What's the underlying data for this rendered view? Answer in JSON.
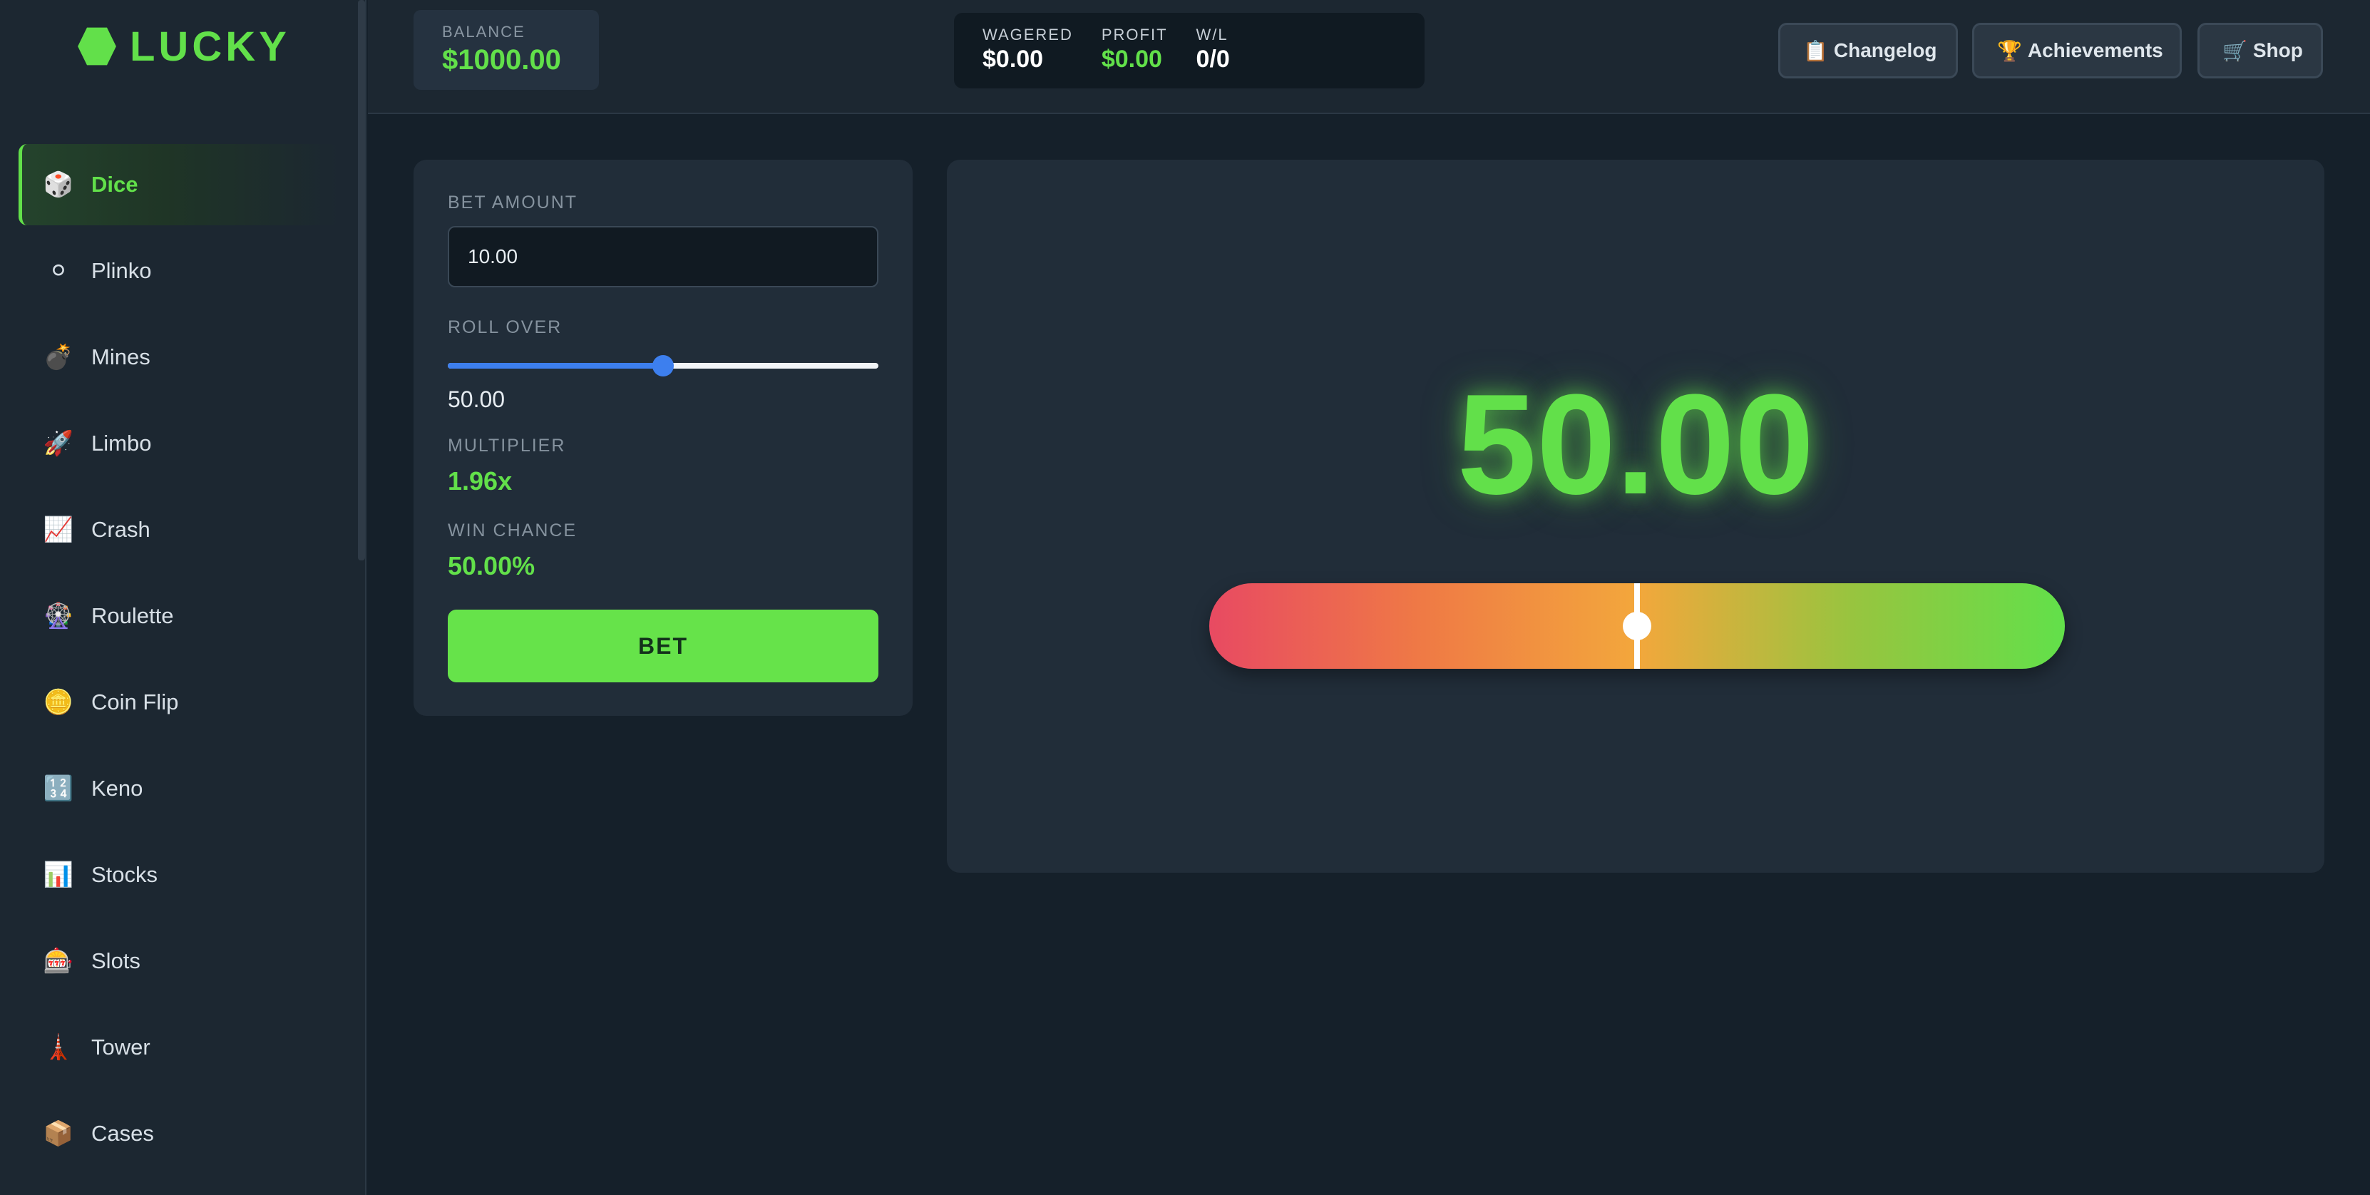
{
  "brand": {
    "name": "LUCKY",
    "icon": "hexagon-logo-icon",
    "color": "#62e04a"
  },
  "sidebar": {
    "active_index": 0,
    "items": [
      {
        "label": "Dice",
        "icon": "🎲",
        "icon_name": "dice-icon"
      },
      {
        "label": "Plinko",
        "icon": "⚪",
        "icon_name": "plinko-ball-icon"
      },
      {
        "label": "Mines",
        "icon": "💣",
        "icon_name": "bomb-icon"
      },
      {
        "label": "Limbo",
        "icon": "🚀",
        "icon_name": "rocket-icon"
      },
      {
        "label": "Crash",
        "icon": "📈",
        "icon_name": "chart-up-icon"
      },
      {
        "label": "Roulette",
        "icon": "🎡",
        "icon_name": "ferris-wheel-icon"
      },
      {
        "label": "Coin Flip",
        "icon": "🪙",
        "icon_name": "coin-icon"
      },
      {
        "label": "Keno",
        "icon": "🔢",
        "icon_name": "numbers-icon"
      },
      {
        "label": "Stocks",
        "icon": "📊",
        "icon_name": "bar-chart-icon"
      },
      {
        "label": "Slots",
        "icon": "🎰",
        "icon_name": "slot-machine-icon"
      },
      {
        "label": "Tower",
        "icon": "🗼",
        "icon_name": "tower-icon"
      },
      {
        "label": "Cases",
        "icon": "📦",
        "icon_name": "package-icon"
      }
    ]
  },
  "header": {
    "balance": {
      "label": "BALANCE",
      "value": "$1000.00"
    },
    "stats": {
      "wagered": {
        "label": "WAGERED",
        "value": "$0.00"
      },
      "profit": {
        "label": "PROFIT",
        "value": "$0.00"
      },
      "wl": {
        "label": "W/L",
        "value": "0/0"
      }
    },
    "buttons": {
      "changelog": {
        "icon": "📋",
        "label": "Changelog"
      },
      "achievements": {
        "icon": "🏆",
        "label": "Achievements"
      },
      "shop": {
        "icon": "🛒",
        "label": "Shop"
      }
    }
  },
  "bet_panel": {
    "bet_amount": {
      "label": "BET AMOUNT",
      "value": "10.00"
    },
    "roll_over": {
      "label": "ROLL OVER",
      "value": "50.00",
      "slider_fraction": 0.5
    },
    "multiplier": {
      "label": "MULTIPLIER",
      "value": "1.96x"
    },
    "win_chance": {
      "label": "WIN CHANCE",
      "value": "50.00%"
    },
    "bet_button": {
      "label": "BET"
    }
  },
  "game": {
    "result": "50.00",
    "result_fraction": 0.5,
    "colors": {
      "win": "#62e04a",
      "low": "#e84a62",
      "mid": "#f3a73c"
    }
  }
}
